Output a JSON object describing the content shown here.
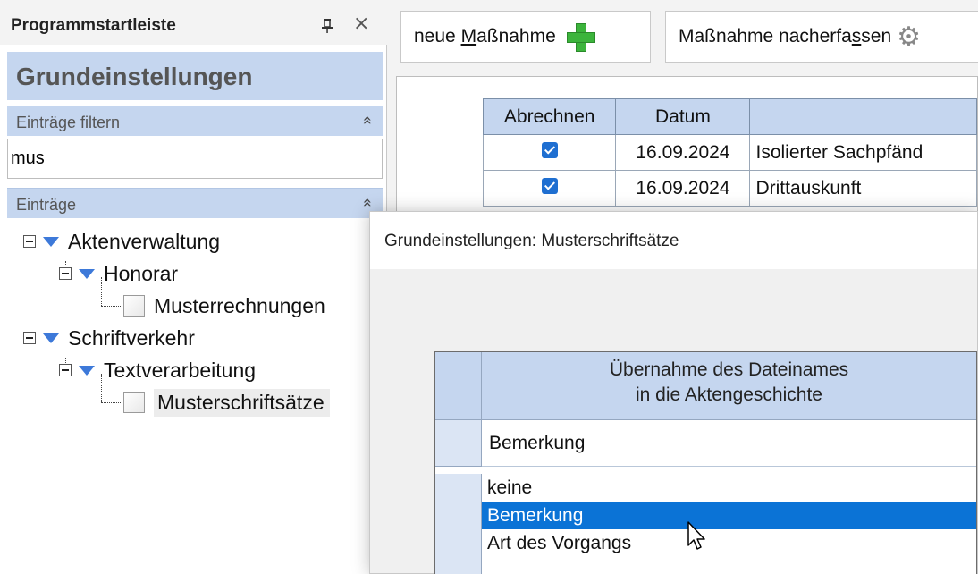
{
  "panel": {
    "title": "Programmstartleiste",
    "pin_icon": "pin-icon",
    "close_icon": "close-icon",
    "close_glyph": "×"
  },
  "settings_header": "Grundeinstellungen",
  "filter": {
    "label": "Einträge filtern",
    "chevron": "»",
    "value": "mus"
  },
  "entries": {
    "label": "Einträge",
    "chevron": "»"
  },
  "tree": {
    "n1": "Aktenverwaltung",
    "n2": "Honorar",
    "n3": "Musterrechnungen",
    "n4": "Schriftverkehr",
    "n5": "Textverarbeitung",
    "n6": "Musterschriftsätze"
  },
  "toolbar": {
    "new_measure_prefix": "neue ",
    "new_measure_underlined": "M",
    "new_measure_suffix": "aßnahme",
    "followup_prefix": "Maßnahme nacherfa",
    "followup_underlined": "s",
    "followup_suffix": "sen",
    "gear_glyph": "⚙"
  },
  "table": {
    "headers": [
      "Abrechnen",
      "Datum",
      ""
    ],
    "rows": [
      {
        "checked": true,
        "date": "16.09.2024",
        "text": "Isolierter Sachpfänd"
      },
      {
        "checked": true,
        "date": "16.09.2024",
        "text": "Drittauskunft"
      }
    ]
  },
  "dialog": {
    "title": "Grundeinstellungen: Musterschriftsätze",
    "column_header_line1": "Übernahme des Dateinames",
    "column_header_line2": "in die Aktengeschichte",
    "current_value": "Bemerkung",
    "options": [
      "keine",
      "Bemerkung",
      "Art des Vorgangs"
    ],
    "selected_option": "Bemerkung"
  },
  "colors": {
    "header_blue": "#c5d6ef",
    "selection_blue": "#0b73d6",
    "checkbox_blue": "#1f6fd1",
    "plus_green": "#3cb43c"
  }
}
